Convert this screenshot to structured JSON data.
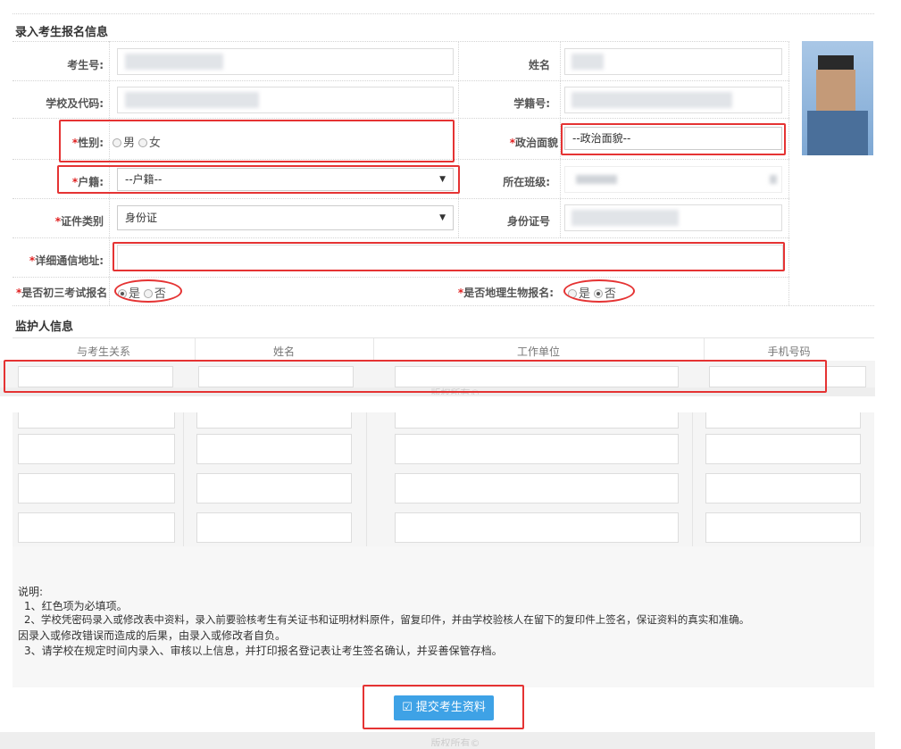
{
  "sections": {
    "enroll_title": "录入考生报名信息",
    "guardian_title": "监护人信息"
  },
  "labels": {
    "exam_no": "考生号:",
    "name": "姓名",
    "school": "学校及代码:",
    "student_no": "学籍号:",
    "gender": "性别:",
    "political": "政治面貌",
    "huji": "户籍:",
    "class": "所在班级:",
    "id_type": "证件类别",
    "id_no": "身份证号",
    "address": "详细通信地址:",
    "chu3": "是否初三考试报名",
    "geo_bio": "是否地理生物报名:"
  },
  "required_mark": "*",
  "gender_options": {
    "male": "男",
    "female": "女"
  },
  "yes_no": {
    "yes": "是",
    "no": "否"
  },
  "selects": {
    "political_value": "--政治面貌--",
    "huji_value": "--户籍--",
    "id_type_value": "身份证"
  },
  "guardian_headers": [
    "与考生关系",
    "姓名",
    "工作单位",
    "手机号码"
  ],
  "footer_copyright": "版权所有©",
  "notes": {
    "title": "说明:",
    "lines": [
      "1、红色项为必填项。",
      "2、学校凭密码录入或修改表中资料，录入前要验核考生有关证书和证明材料原件，留复印件，并由学校验核人在留下的复印件上签名，保证资料的真实和准确。",
      "因录入或修改错误而造成的后果，由录入或修改者自负。",
      "3、请学校在规定时间内录入、审核以上信息，并打印报名登记表让考生签名确认，并妥善保管存档。"
    ]
  },
  "submit_label": "提交考生资料",
  "icons": {
    "submit": "edit-icon",
    "dropdown": "caret-down-icon"
  },
  "colors": {
    "highlight": "#e53333",
    "button": "#3ea2e6",
    "required": "#e02020"
  }
}
